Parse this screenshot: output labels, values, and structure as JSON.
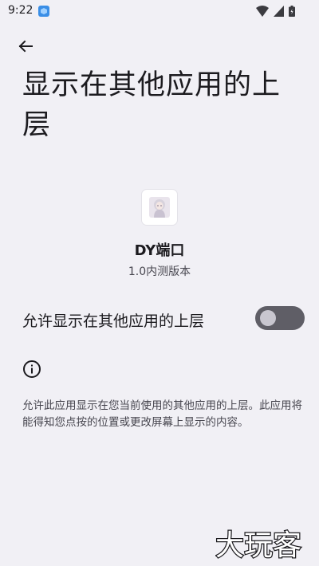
{
  "status_bar": {
    "time": "9:22",
    "icons": [
      "app-notification-icon",
      "wifi-icon",
      "signal-icon",
      "battery-icon"
    ]
  },
  "header": {
    "back_icon": "arrow-left-icon",
    "title": "显示在其他应用的上层"
  },
  "app": {
    "name": "DY端口",
    "version": "1.0内测版本"
  },
  "permission": {
    "toggle_label": "允许显示在其他应用的上层",
    "toggle_enabled": false
  },
  "info": {
    "icon": "info-icon",
    "text": "允许此应用显示在您当前使用的其他应用的上层。此应用将能得知您点按的位置或更改屏幕上显示的内容。"
  },
  "watermark": {
    "text": "大玩客"
  },
  "colors": {
    "background": "#f1f0f5",
    "toggle_track_off": "#5f5e66",
    "toggle_knob_off": "#c8c6cf"
  }
}
